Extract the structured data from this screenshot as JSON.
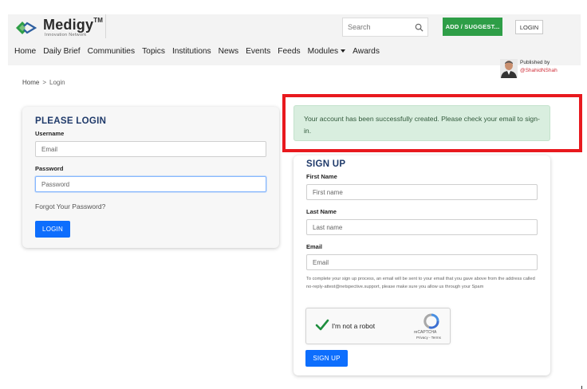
{
  "header": {
    "logo_title": "Medigy",
    "logo_tm": "TM",
    "logo_subtitle": "Innovation Network",
    "search_placeholder": "Search",
    "add_button": "ADD / SUGGEST...",
    "login_button": "LOGIN",
    "nav": [
      {
        "label": "Home"
      },
      {
        "label": "Daily Brief"
      },
      {
        "label": "Communities"
      },
      {
        "label": "Topics"
      },
      {
        "label": "Institutions"
      },
      {
        "label": "News"
      },
      {
        "label": "Events"
      },
      {
        "label": "Feeds"
      },
      {
        "label": "Modules"
      },
      {
        "label": "Awards"
      }
    ],
    "published_by_label": "Published by",
    "published_by_handle": "@ShahidNShah"
  },
  "breadcrumb": {
    "home": "Home",
    "separator": ">",
    "current": "Login"
  },
  "login": {
    "title": "PLEASE LOGIN",
    "username_label": "Username",
    "username_placeholder": "Email",
    "password_label": "Password",
    "password_placeholder": "Password",
    "forgot_link": "Forgot Your Password?",
    "submit": "LOGIN"
  },
  "alert": {
    "message": "Your account has been successfully created. Please check your email to sign-in.",
    "highlight_color": "#e8191e"
  },
  "signup": {
    "title": "SIGN UP",
    "first_name_label": "First Name",
    "first_name_placeholder": "First name",
    "last_name_label": "Last Name",
    "last_name_placeholder": "Last name",
    "email_label": "Email",
    "email_placeholder": "Email",
    "note": "To complete your sign up process, an email will be sent to your email that you gave above from the address called no-reply-attest@netspective.support, please make sure you allow us through your Spam",
    "recaptcha_label": "I'm not a robot",
    "recaptcha_brand": "reCAPTCHA",
    "recaptcha_terms": "Privacy - Terms",
    "submit": "SIGN UP"
  },
  "colors": {
    "primary": "#0d6efd",
    "green_button": "#2e9e47",
    "title_blue": "#1f3a6a",
    "alert_bg": "#d9eedf"
  }
}
